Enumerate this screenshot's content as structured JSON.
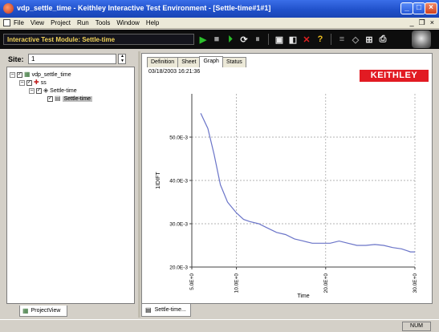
{
  "window": {
    "title": "vdp_settle_time - Keithley Interactive Test Environment - [Settle-time#1#1]",
    "minimize": "_",
    "maximize": "□",
    "close": "×"
  },
  "menu": {
    "items": [
      "File",
      "View",
      "Project",
      "Run",
      "Tools",
      "Window",
      "Help"
    ],
    "mdi_minimize": "_",
    "mdi_restore": "❐",
    "mdi_close": "×"
  },
  "toolbar": {
    "module_label": "Interactive Test Module: Settle-time"
  },
  "site": {
    "label": "Site:",
    "value": "1"
  },
  "tree": {
    "root": "vdp_settle_time",
    "child": "ss",
    "grandchild": "Settle-time",
    "leaf": "Settle-time"
  },
  "left_tab": {
    "label": "ProjectView"
  },
  "tabs": [
    "Definition",
    "Sheet",
    "Graph",
    "Status"
  ],
  "active_tab": "Graph",
  "timestamp": "03/18/2003 16:21:36",
  "logo_text": "KEITHLEY",
  "doc_tab": {
    "label": "Settle-time..."
  },
  "status": {
    "num": "NUM"
  },
  "colors": {
    "line": "#6a74c8",
    "logo": "#e21b23",
    "module_text": "#f2d45a"
  },
  "chart_data": {
    "type": "line",
    "title": "",
    "xlabel": "Time",
    "ylabel": "1IDIFT",
    "xlim": [
      5,
      30
    ],
    "ylim": [
      20,
      60
    ],
    "x_ticks": [
      5,
      10,
      20,
      30
    ],
    "x_tick_labels": [
      "5.0E+0",
      "10.0E+0",
      "20.0E+0",
      "30.0E+0"
    ],
    "y_ticks": [
      20,
      30,
      40,
      50
    ],
    "y_tick_labels": [
      "20.0E-3",
      "30.0E-3",
      "40.0E-3",
      "50.0E-3"
    ],
    "grid": true,
    "series": [
      {
        "x": [
          6.0,
          6.8,
          7.5,
          8.2,
          9.0,
          10.0,
          10.8,
          11.5,
          12.5,
          13.5,
          14.5,
          15.5,
          16.5,
          17.5,
          18.5,
          19.5,
          20.5,
          21.5,
          22.5,
          23.5,
          24.5,
          25.5,
          26.5,
          27.5,
          28.5,
          29.5,
          30.0
        ],
        "y": [
          55.5,
          52.0,
          46.0,
          39.0,
          35.0,
          32.5,
          31.0,
          30.5,
          30.0,
          29.0,
          28.0,
          27.5,
          26.5,
          26.0,
          25.5,
          25.5,
          25.5,
          26.0,
          25.5,
          25.0,
          25.0,
          25.2,
          25.0,
          24.5,
          24.2,
          23.5,
          23.5
        ]
      }
    ]
  }
}
